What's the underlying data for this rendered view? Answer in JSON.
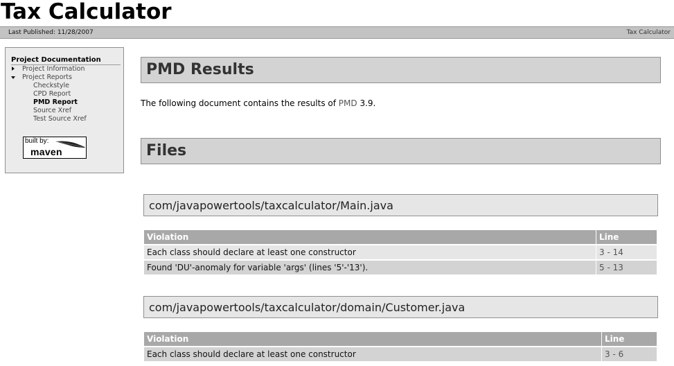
{
  "banner": {
    "title": "Tax Calculator"
  },
  "breadcrumbs": {
    "last_published": "Last Published: 11/28/2007",
    "right_link": "Tax Calculator"
  },
  "sidebar": {
    "heading": "Project Documentation",
    "items": [
      {
        "label": "Project Information",
        "icon": "triangle-right-icon",
        "level": 1
      },
      {
        "label": "Project Reports",
        "icon": "triangle-down-icon",
        "level": 1
      },
      {
        "label": "Checkstyle",
        "level": 2
      },
      {
        "label": "CPD Report",
        "level": 2
      },
      {
        "label": "PMD Report",
        "level": 2,
        "active": true
      },
      {
        "label": "Source Xref",
        "level": 2
      },
      {
        "label": "Test Source Xref",
        "level": 2
      }
    ],
    "badge": {
      "built_by": "built by:",
      "maven": "maven",
      "icon": "feather-icon"
    }
  },
  "main": {
    "title": "PMD Results",
    "intro_prefix": "The following document contains the results of ",
    "intro_link": "PMD",
    "intro_suffix": " 3.9.",
    "files_heading": "Files",
    "files": [
      {
        "name": "com/javapowertools/taxcalculator/Main.java",
        "headers": [
          "Violation",
          "Line"
        ],
        "rows": [
          {
            "violation": "Each class should declare at least one constructor",
            "line": "3 - 14"
          },
          {
            "violation": "Found 'DU'-anomaly for variable 'args' (lines '5'-'13').",
            "line": "5 - 13"
          }
        ]
      },
      {
        "name": "com/javapowertools/taxcalculator/domain/Customer.java",
        "headers": [
          "Violation",
          "Line"
        ],
        "rows": [
          {
            "violation": "Each class should declare at least one constructor",
            "line": "3 - 6"
          }
        ]
      }
    ]
  }
}
